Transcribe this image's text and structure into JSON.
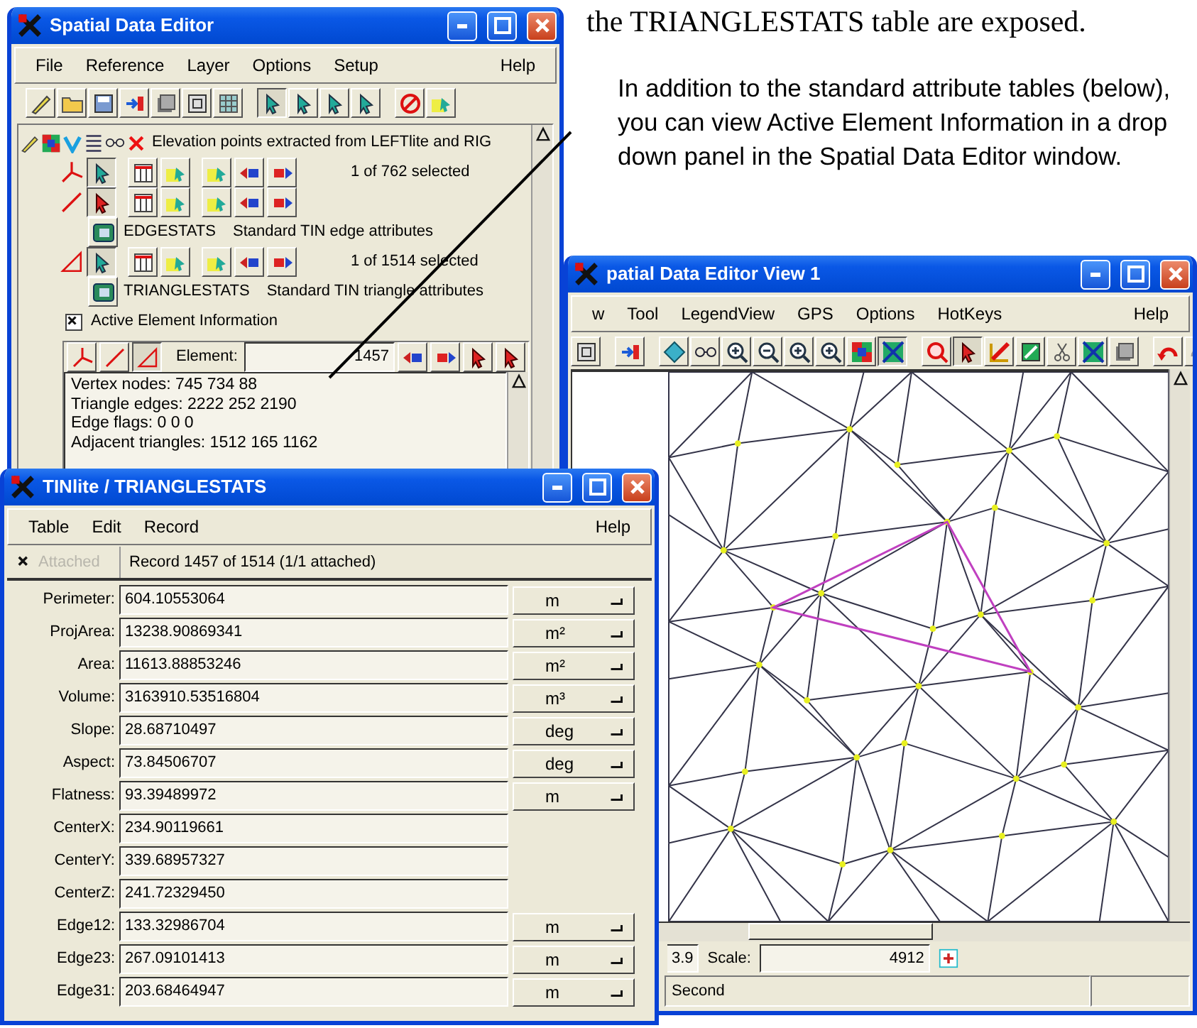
{
  "page_heading": "the TRIANGLESTATS table are exposed.",
  "callout": "In addition to the standard attribute tables (below), you can view Active Element Information in a drop down panel in the Spatial Data Editor window.",
  "editor_window": {
    "title": "Spatial Data Editor",
    "menu": [
      "File",
      "Reference",
      "Layer",
      "Options",
      "Setup"
    ],
    "help_menu": "Help",
    "layer_name": "Elevation points extracted from LEFTlite and RIG",
    "elements": [
      {
        "kind": "point",
        "selection": "1 of 762 selected"
      },
      {
        "kind": "line",
        "tables": [
          {
            "name": "EDGESTATS",
            "description": "Standard TIN edge attributes"
          }
        ]
      },
      {
        "kind": "triangle",
        "selection": "1 of 1514 selected",
        "tables": [
          {
            "name": "TRIANGLESTATS",
            "description": "Standard TIN triangle attributes"
          }
        ]
      }
    ],
    "active_element": {
      "label": "Active Element Information",
      "checked": true,
      "element_label": "Element:",
      "element_value": "1457",
      "info_lines": [
        "Vertex nodes: 745 734 88",
        "Triangle edges: 2222 252 2190",
        "Edge flags: 0 0 0",
        "Adjacent triangles: 1512 165 1162"
      ]
    }
  },
  "view_window": {
    "title": "patial Data Editor View 1",
    "menu": [
      "w",
      "Tool",
      "LegendView",
      "GPS",
      "Options",
      "HotKeys"
    ],
    "help_menu": "Help",
    "zoom_value": "3.9",
    "scale_label": "Scale:",
    "scale_value": "4912",
    "status": "Second"
  },
  "table_window": {
    "title": "TINlite / TRIANGLESTATS",
    "menu": [
      "Table",
      "Edit",
      "Record"
    ],
    "help_menu": "Help",
    "attached": {
      "label": "Attached",
      "checked": true,
      "disabled": true
    },
    "record": "Record 1457 of 1514 (1/1 attached)",
    "fields": [
      {
        "label": "Perimeter:",
        "value": "604.10553064",
        "unit": "m"
      },
      {
        "label": "ProjArea:",
        "value": "13238.90869341",
        "unit": "m²"
      },
      {
        "label": "Area:",
        "value": "11613.88853246",
        "unit": "m²"
      },
      {
        "label": "Volume:",
        "value": "3163910.53516804",
        "unit": "m³"
      },
      {
        "label": "Slope:",
        "value": "28.68710497",
        "unit": "deg"
      },
      {
        "label": "Aspect:",
        "value": "73.84506707",
        "unit": "deg"
      },
      {
        "label": "Flatness:",
        "value": "93.39489972",
        "unit": "m"
      },
      {
        "label": "CenterX:",
        "value": "234.90119661"
      },
      {
        "label": "CenterY:",
        "value": "339.68957327"
      },
      {
        "label": "CenterZ:",
        "value": "241.72329450"
      },
      {
        "label": "Edge12:",
        "value": "133.32986704",
        "unit": "m"
      },
      {
        "label": "Edge23:",
        "value": "267.09101413",
        "unit": "m"
      },
      {
        "label": "Edge31:",
        "value": "203.68464947",
        "unit": "m"
      }
    ]
  }
}
